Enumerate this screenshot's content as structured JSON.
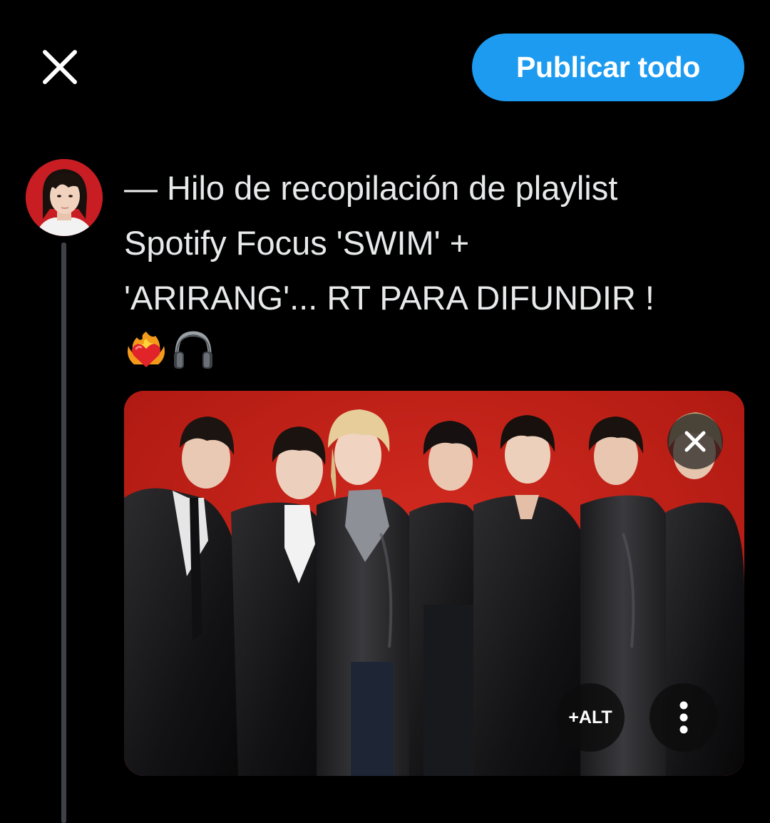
{
  "header": {
    "close_icon": "close-icon",
    "publish_label": "Publicar todo",
    "publish_color": "#1d9bf0"
  },
  "post": {
    "text": "— Hilo de recopilación de playlist\nSpotify Focus 'SWIM' +\n'ARIRANG'... RT PARA DIFUNDIR !",
    "emojis": [
      "❤️‍🔥",
      "🎧"
    ]
  },
  "media": {
    "remove_icon": "close-icon",
    "alt_label": "+ALT",
    "more_icon": "more-vertical-icon",
    "background_color": "#c0201a"
  },
  "thread_line_color": "#3e4246"
}
